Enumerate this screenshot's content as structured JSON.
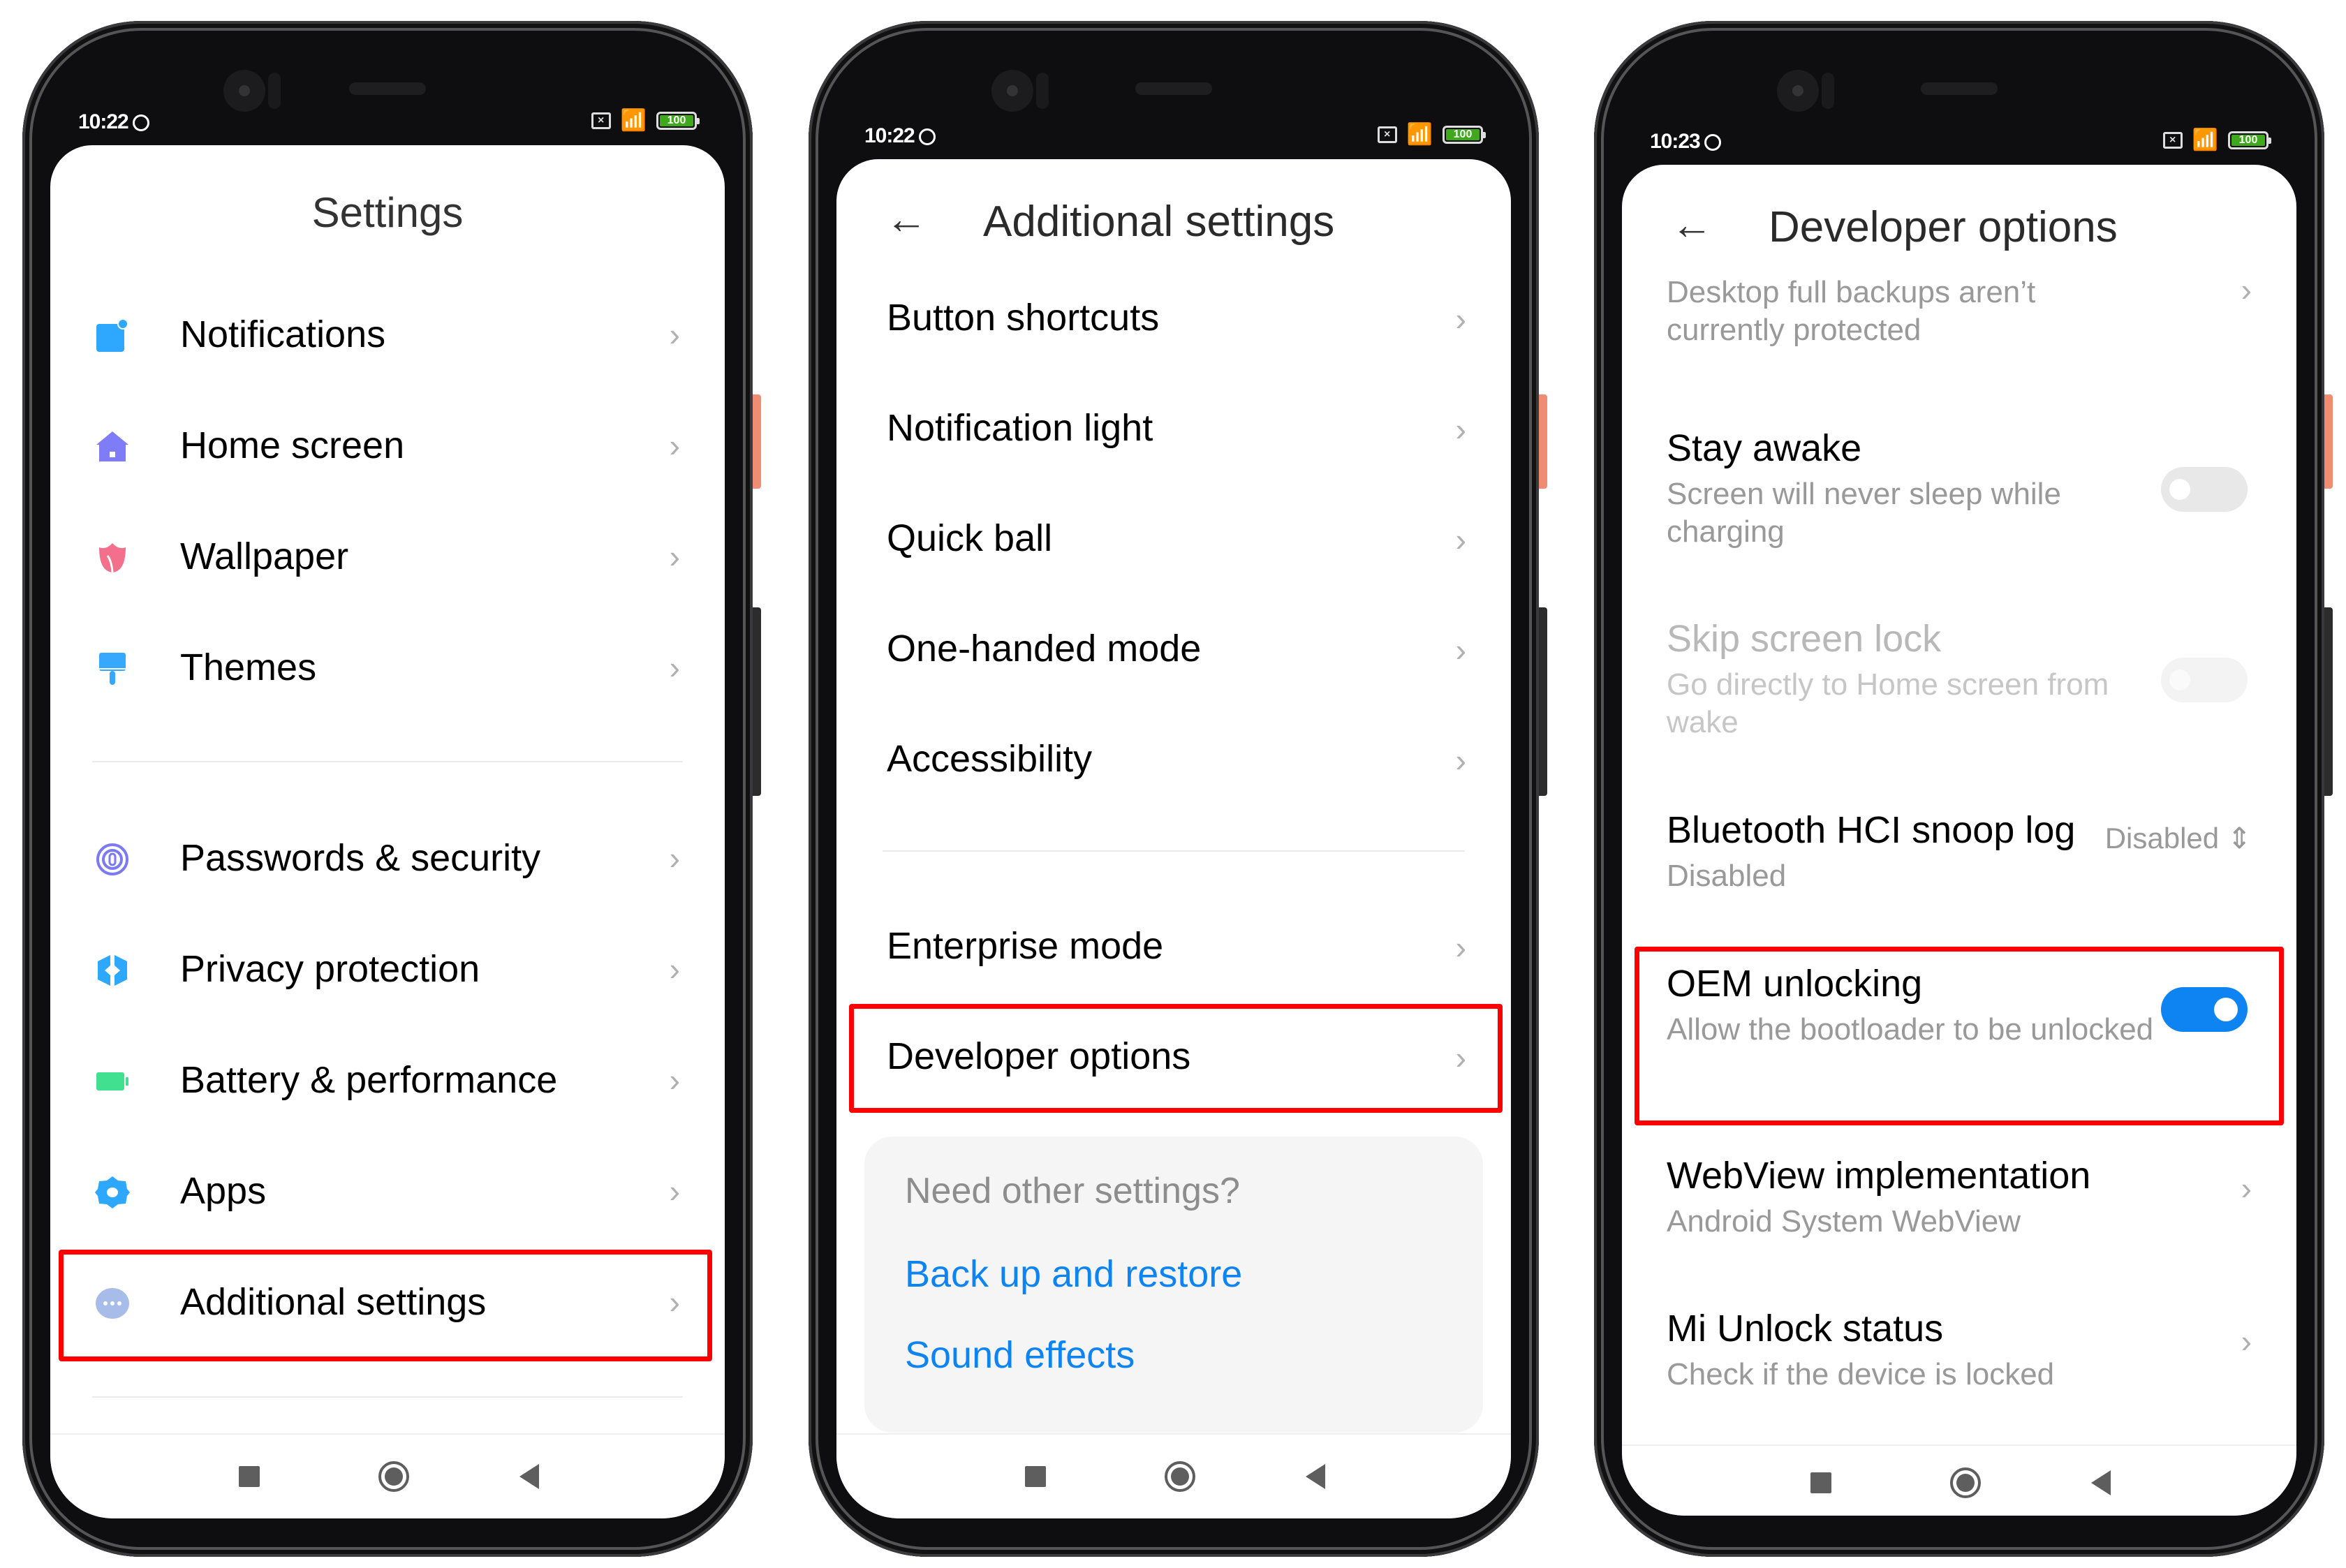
{
  "colors": {
    "highlight": "#ff0000",
    "accent_blue": "#0d84f2",
    "toggle_on": "#0d84f2",
    "battery_green": "#3fa81c"
  },
  "phones": [
    {
      "status": {
        "time": "10:22",
        "battery": "100",
        "sim_icon": "sim-absent-icon",
        "wifi_icon": "wifi-icon"
      },
      "title": "Settings",
      "group1": [
        {
          "label": "Notifications",
          "icon": "notifications-icon",
          "color": "#2ea8ff"
        },
        {
          "label": "Home screen",
          "icon": "home-icon",
          "color": "#7f7cf7"
        },
        {
          "label": "Wallpaper",
          "icon": "tulip-icon",
          "color": "#f2708c"
        },
        {
          "label": "Themes",
          "icon": "paintbrush-icon",
          "color": "#36a9ff"
        }
      ],
      "group2": [
        {
          "label": "Passwords & security",
          "icon": "fingerprint-icon",
          "color": "#7b7af2"
        },
        {
          "label": "Privacy protection",
          "icon": "privacy-icon",
          "color": "#2ea8ff"
        },
        {
          "label": "Battery & performance",
          "icon": "battery-icon",
          "color": "#41e090"
        },
        {
          "label": "Apps",
          "icon": "gear-icon",
          "color": "#2ea8ff"
        },
        {
          "label": "Additional settings",
          "icon": "more-icon",
          "color": "#a8bce9",
          "highlighted": true
        }
      ]
    },
    {
      "status": {
        "time": "10:22",
        "battery": "100",
        "sim_icon": "sim-absent-icon",
        "wifi_icon": "wifi-icon"
      },
      "title": "Additional settings",
      "group1": [
        {
          "label": "Button shortcuts"
        },
        {
          "label": "Notification light"
        },
        {
          "label": "Quick ball"
        },
        {
          "label": "One-handed mode"
        },
        {
          "label": "Accessibility"
        }
      ],
      "group2": [
        {
          "label": "Enterprise mode"
        },
        {
          "label": "Developer options",
          "highlighted": true
        }
      ],
      "card": {
        "question": "Need other settings?",
        "links": [
          "Back up and restore",
          "Sound effects"
        ]
      }
    },
    {
      "status": {
        "time": "10:23",
        "battery": "100",
        "sim_icon": "sim-absent-icon",
        "wifi_icon": "wifi-icon"
      },
      "title": "Developer options",
      "items": [
        {
          "title": "",
          "subtitle": "Desktop full backups aren’t currently protected",
          "control": "chevron"
        },
        {
          "title": "Stay awake",
          "subtitle": "Screen will never sleep while charging",
          "control": "toggle",
          "on": false
        },
        {
          "title": "Skip screen lock",
          "subtitle": "Go directly to Home screen from wake",
          "control": "toggle",
          "on": false,
          "disabled": true
        },
        {
          "title": "Bluetooth HCI snoop log",
          "subtitle": "Disabled",
          "control": "dropdown",
          "value": "Disabled"
        },
        {
          "title": "OEM unlocking",
          "subtitle": "Allow the bootloader to be unlocked",
          "control": "toggle",
          "on": true,
          "highlighted": true
        },
        {
          "title": "WebView implementation",
          "subtitle": "Android System WebView",
          "control": "chevron"
        },
        {
          "title": "Mi Unlock status",
          "subtitle": "Check if the device is locked",
          "control": "chevron"
        }
      ]
    }
  ]
}
